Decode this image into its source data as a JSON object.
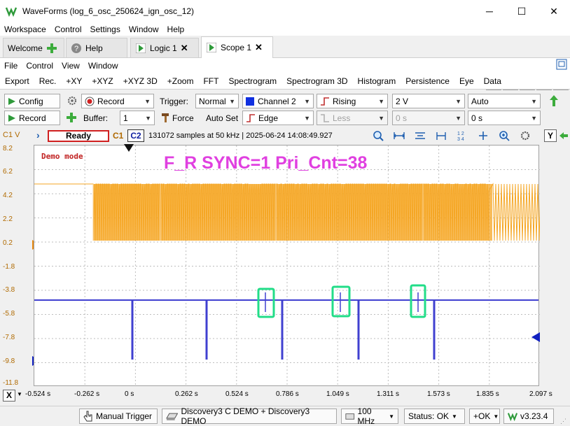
{
  "window": {
    "title": "WaveForms (log_6_osc_250624_ign_osc_12)",
    "minimize": "─",
    "maximize": "☐",
    "close": "✕"
  },
  "menu": [
    "Workspace",
    "Control",
    "Settings",
    "Window",
    "Help"
  ],
  "tabs": [
    {
      "label": "Welcome",
      "icon": "plus-icon"
    },
    {
      "label": "Help",
      "icon": "help-icon"
    },
    {
      "label": "Logic 1",
      "icon": "play-icon"
    },
    {
      "label": "Scope 1",
      "icon": "play-icon"
    }
  ],
  "scope_menu": [
    "File",
    "Control",
    "View",
    "Window"
  ],
  "view_toolbar": [
    "Export",
    "Rec.",
    "+XY",
    "+XYZ",
    "+XYZ 3D",
    "+Zoom",
    "FFT",
    "Spectrogram",
    "Spectrogram 3D",
    "Histogram",
    "Persistence",
    "Eye",
    "Data"
  ],
  "controls": {
    "config": "Config",
    "record_btn": "Record",
    "record_mode": "Record",
    "trigger_label": "Trigger:",
    "trigger_mode": "Normal",
    "trigger_source": "Channel 2",
    "trigger_condition": "Rising",
    "trigger_level": "2 V",
    "trigger_auto": "Auto",
    "buffer_label": "Buffer:",
    "buffer_value": "1",
    "force": "Force",
    "auto_set": "Auto Set",
    "trigger_type": "Edge",
    "less": "Less",
    "hold_value": "0 s",
    "position_value": "0 s"
  },
  "plot_header": {
    "c1_label": "C1 V",
    "status": "Ready",
    "c1": "C1",
    "c2": "C2",
    "info": "131072 samples at 50 kHz  | 2025-06-24  14:08:49.927",
    "y_button": "Y"
  },
  "plot": {
    "demo": "Demo mode",
    "annotation": "F_R SYNC=1 Pri_Cnt=38",
    "y_ticks": [
      "8.2",
      "6.2",
      "4.2",
      "2.2",
      "0.2",
      "-1.8",
      "-3.8",
      "-5.8",
      "-7.8",
      "-9.8",
      "-11.8"
    ],
    "x_ticks": [
      "-0.524 s",
      "-0.262 s",
      "0 s",
      "0.262 s",
      "0.524 s",
      "0.786 s",
      "1.049 s",
      "1.311 s",
      "1.573 s",
      "1.835 s",
      "2.097 s"
    ],
    "colors": {
      "c1": "#f5a623",
      "c2": "#4040d0",
      "annotation": "#e040e0",
      "highlight": "#22dd88"
    }
  },
  "x_axis": {
    "label": "X"
  },
  "status": {
    "manual_trigger": "Manual Trigger",
    "device": "Discovery3 C DEMO + Discovery3 DEMO",
    "freq": "100 MHz",
    "status": "Status: OK",
    "ok": "+OK",
    "version": "v3.23.4"
  }
}
